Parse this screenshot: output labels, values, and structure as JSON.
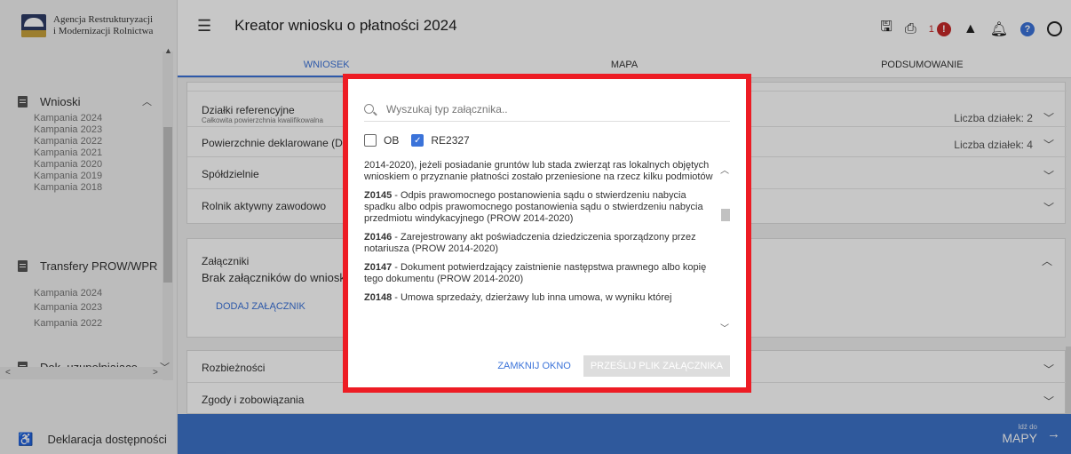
{
  "logo": {
    "line1": "Agencja Restrukturyzacji",
    "line2": "i Modernizacji Rolnictwa"
  },
  "sidebar": {
    "sections": [
      {
        "label": "Wnioski",
        "chevron": "^",
        "items": [
          "Kampania 2024",
          "Kampania 2023",
          "Kampania 2022",
          "Kampania 2021",
          "Kampania 2020",
          "Kampania 2019",
          "Kampania 2018"
        ]
      },
      {
        "label": "Transfery PROW/WPR",
        "chevron": "",
        "items": [
          "Kampania 2024",
          "Kampania 2023",
          "Kampania 2022"
        ]
      },
      {
        "label": "Dok. uzupełniające",
        "chevron": "⌄",
        "items": []
      }
    ],
    "accessibility": "Deklaracja dostępności"
  },
  "header": {
    "title": "Kreator wniosku o płatności 2024",
    "notif_count": "1"
  },
  "tabs": [
    "WNIOSEK",
    "MAPA",
    "PODSUMOWANIE"
  ],
  "rows": {
    "dzialki": {
      "label": "Działki referencyjne",
      "sub": "Całkowita powierzchnia kwalifikowalna",
      "right": "Liczba działek: 2"
    },
    "powierzchnie": {
      "label": "Powierzchnie deklarowane (Dz",
      "right": "Liczba działek: 4"
    },
    "spoldzielnie": {
      "label": "Spółdzielnie"
    },
    "rolnik": {
      "label": "Rolnik aktywny zawodowo"
    },
    "zalaczniki": {
      "label": "Załączniki",
      "sub": "Brak załączników do wniosku",
      "action": "DODAJ ZAŁĄCZNIK"
    },
    "rozbieznosci": {
      "label": "Rozbieżności"
    },
    "zgody": {
      "label": "Zgody i zobowiązania"
    }
  },
  "bottom": {
    "small": "Idź do",
    "big": "MAPY"
  },
  "modal": {
    "search_placeholder": "Wyszukaj typ załącznika..",
    "filters": [
      {
        "label": "OB",
        "checked": false
      },
      {
        "label": "RE2327",
        "checked": true
      }
    ],
    "items": [
      {
        "code": "",
        "text": "2014-2020), jeżeli posiadanie gruntów lub stada zwierząt ras lokalnych objętych wnioskiem o przyznanie płatności zostało przeniesione na rzecz kilku podmiotów"
      },
      {
        "code": "Z0145",
        "text": " - Odpis prawomocnego postanowienia sądu o stwierdzeniu nabycia spadku albo odpis prawomocnego postanowienia sądu o stwierdzeniu nabycia przedmiotu windykacyjnego (PROW 2014-2020)"
      },
      {
        "code": "Z0146",
        "text": " - Zarejestrowany akt poświadczenia dziedziczenia sporządzony przez notariusza (PROW 2014-2020)"
      },
      {
        "code": "Z0147",
        "text": " - Dokument potwierdzający zaistnienie następstwa prawnego albo kopię tego dokumentu (PROW 2014-2020)"
      },
      {
        "code": "Z0148",
        "text": " - Umowa sprzedaży, dzierżawy lub inna umowa, w wyniku której"
      }
    ],
    "close_label": "ZAMKNIJ OKNO",
    "send_label": "PRZEŚLIJ PLIK ZAŁĄCZNIKA"
  },
  "colors": {
    "accent": "#3b73d9",
    "highlight": "#ed1c24",
    "bottom_bar": "#3d73c8",
    "error": "#c62828"
  }
}
